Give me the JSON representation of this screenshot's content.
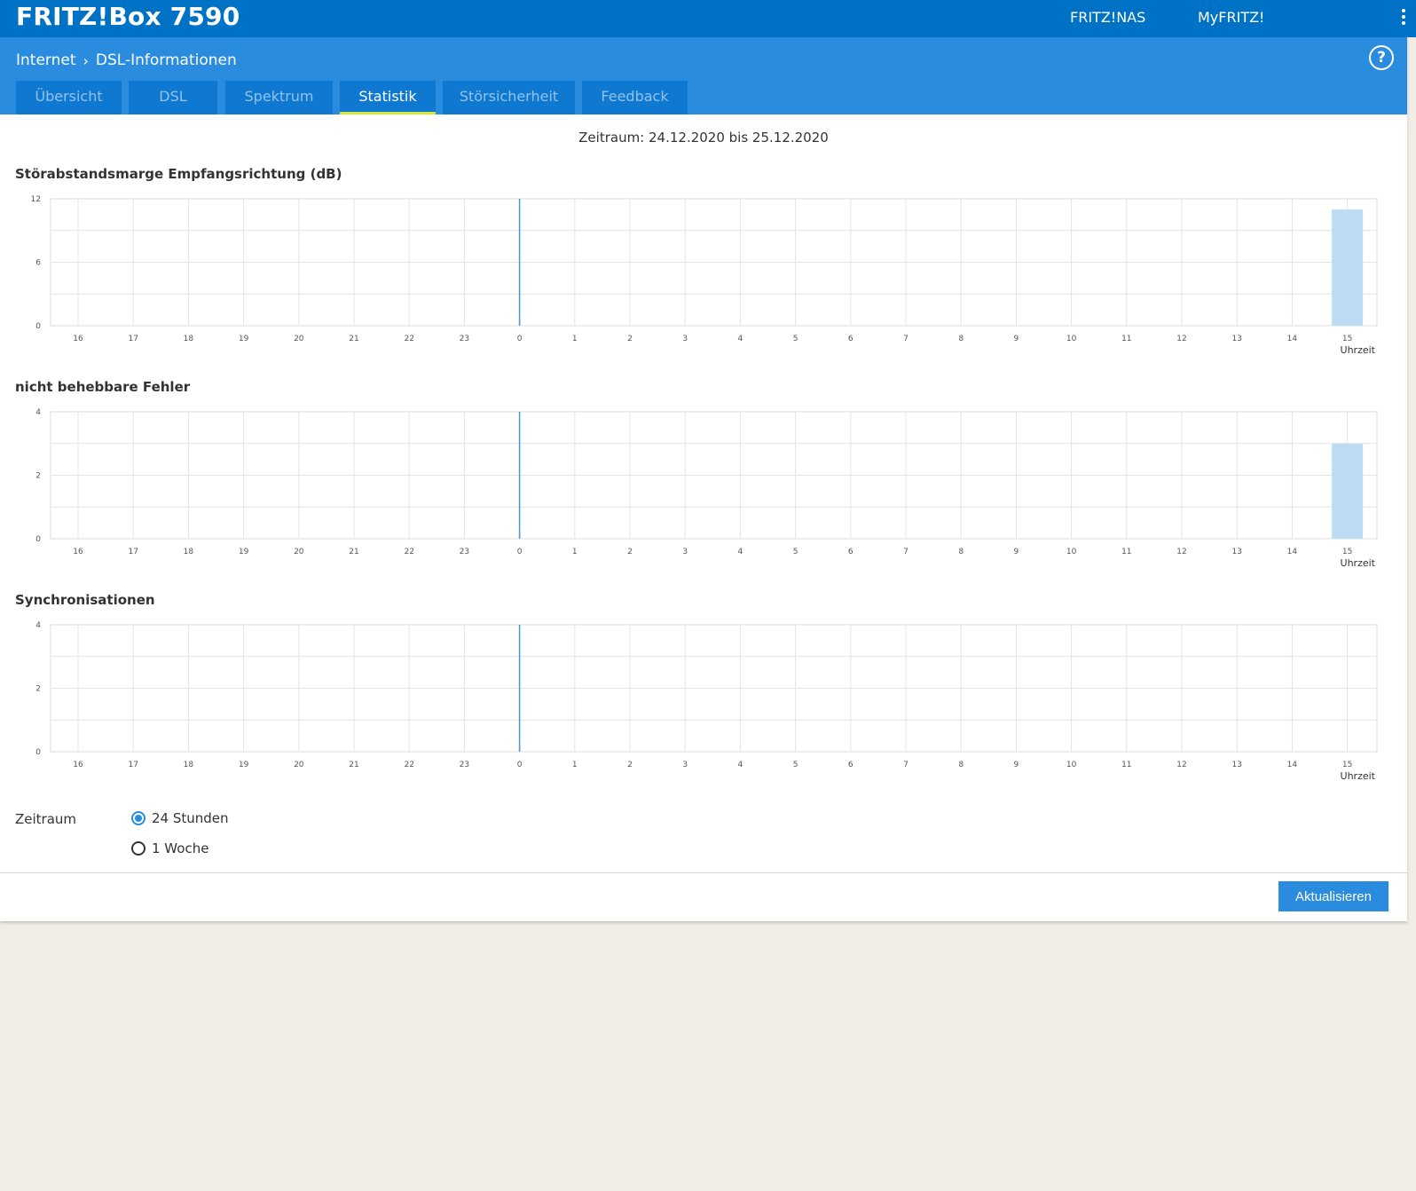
{
  "header": {
    "brand": "FRITZ!Box 7590",
    "links": [
      "FRITZ!NAS",
      "MyFRITZ!"
    ]
  },
  "breadcrumb": [
    "Internet",
    "DSL-Informationen"
  ],
  "help_label": "?",
  "tabs": [
    {
      "label": "Übersicht",
      "active": false
    },
    {
      "label": "DSL",
      "active": false
    },
    {
      "label": "Spektrum",
      "active": false
    },
    {
      "label": "Statistik",
      "active": true
    },
    {
      "label": "Störsicherheit",
      "active": false
    },
    {
      "label": "Feedback",
      "active": false
    }
  ],
  "period_text": "Zeitraum: 24.12.2020 bis 25.12.2020",
  "chart_data": [
    {
      "type": "bar",
      "title": "Störabstandsmarge Empfangsrichtung (dB)",
      "categories": [
        "16",
        "17",
        "18",
        "19",
        "20",
        "21",
        "22",
        "23",
        "0",
        "1",
        "2",
        "3",
        "4",
        "5",
        "6",
        "7",
        "8",
        "9",
        "10",
        "11",
        "12",
        "13",
        "14",
        "15"
      ],
      "xlabel": "Uhrzeit",
      "yticks": [
        0,
        6,
        12
      ],
      "ylim": [
        0,
        12
      ],
      "day_boundary": "0",
      "bars": [
        {
          "category": "15",
          "value": 11
        }
      ],
      "bar_color": "#bcdcf4"
    },
    {
      "type": "bar",
      "title": "nicht behebbare Fehler",
      "categories": [
        "16",
        "17",
        "18",
        "19",
        "20",
        "21",
        "22",
        "23",
        "0",
        "1",
        "2",
        "3",
        "4",
        "5",
        "6",
        "7",
        "8",
        "9",
        "10",
        "11",
        "12",
        "13",
        "14",
        "15"
      ],
      "xlabel": "Uhrzeit",
      "yticks": [
        0,
        2,
        4
      ],
      "ylim": [
        0,
        4
      ],
      "day_boundary": "0",
      "bars": [
        {
          "category": "15",
          "value": 3
        }
      ],
      "bar_color": "#bcdcf4"
    },
    {
      "type": "bar",
      "title": "Synchronisationen",
      "categories": [
        "16",
        "17",
        "18",
        "19",
        "20",
        "21",
        "22",
        "23",
        "0",
        "1",
        "2",
        "3",
        "4",
        "5",
        "6",
        "7",
        "8",
        "9",
        "10",
        "11",
        "12",
        "13",
        "14",
        "15"
      ],
      "xlabel": "Uhrzeit",
      "yticks": [
        0,
        2,
        4
      ],
      "ylim": [
        0,
        4
      ],
      "day_boundary": "0",
      "bars": [],
      "bar_color": "#bcdcf4"
    }
  ],
  "zeitraum": {
    "label": "Zeitraum",
    "options": [
      {
        "label": "24 Stunden",
        "selected": true
      },
      {
        "label": "1 Woche",
        "selected": false
      }
    ]
  },
  "refresh_button": "Aktualisieren",
  "colors": {
    "topbar": "#0072c6",
    "subbar": "#2a8cde",
    "tab": "#0f78d0",
    "tab_active_underline": "#d2e63b",
    "accent": "#2a8cde"
  }
}
